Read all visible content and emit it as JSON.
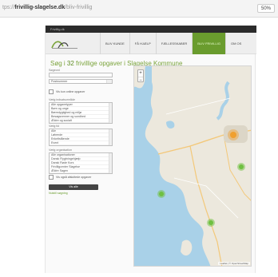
{
  "browser": {
    "url_prefix": "tps://",
    "url_domain": "frivillig-slagelse.dk",
    "url_path": "/bliv-frivillig",
    "zoom_level": "50%"
  },
  "site": {
    "topbar_text": "Frivillig.dk",
    "nav": [
      {
        "label": "Bliv kunde"
      },
      {
        "label": "Få hjælp"
      },
      {
        "label": "Fællesskaber"
      },
      {
        "label": "Bliv frivillig"
      },
      {
        "label": "Om os"
      }
    ],
    "active_nav_index": 3
  },
  "page": {
    "title_pre": "Søg i",
    "title_count": "32",
    "title_post": "frivillige opgaver i Slagelse Kommune"
  },
  "filters": {
    "search_label": "Søgeord",
    "postcode_label": "Postnummer",
    "postcode_value": "Postnummer",
    "only_online_label": "Vis kun online opgaver",
    "area_label": "Vælg indsatsområde",
    "area_options": [
      "Alle opgavetyper",
      "Børn og unge",
      "Bæredygtighed og miljø",
      "Besøgsvenner og sundhed",
      "Ældre og socialt"
    ],
    "time_label": "Vælg tid",
    "time_options": [
      "Alle",
      "Løbende",
      "Enkeltstående",
      "Event"
    ],
    "org_label": "Vælg organisation",
    "org_options": [
      "Alle organisationer",
      "Dansk Flygtningehjælp",
      "Dansk Røde Kors",
      "Frivilligcenter Slagelse",
      "Ældre Sagen"
    ],
    "also_show_label": "Vis også afsluttede opgaver",
    "submit_label": "Vis alle",
    "reset_label": "Nulstil søgning"
  },
  "map": {
    "zoom_in": "+",
    "zoom_out": "−",
    "attribution": "Leaflet | © OpenStreetMap",
    "colors": {
      "water": "#a9d1e8",
      "land": "#ece8dd",
      "cluster_green": "#6fc041",
      "cluster_orange": "#f0a030"
    }
  }
}
